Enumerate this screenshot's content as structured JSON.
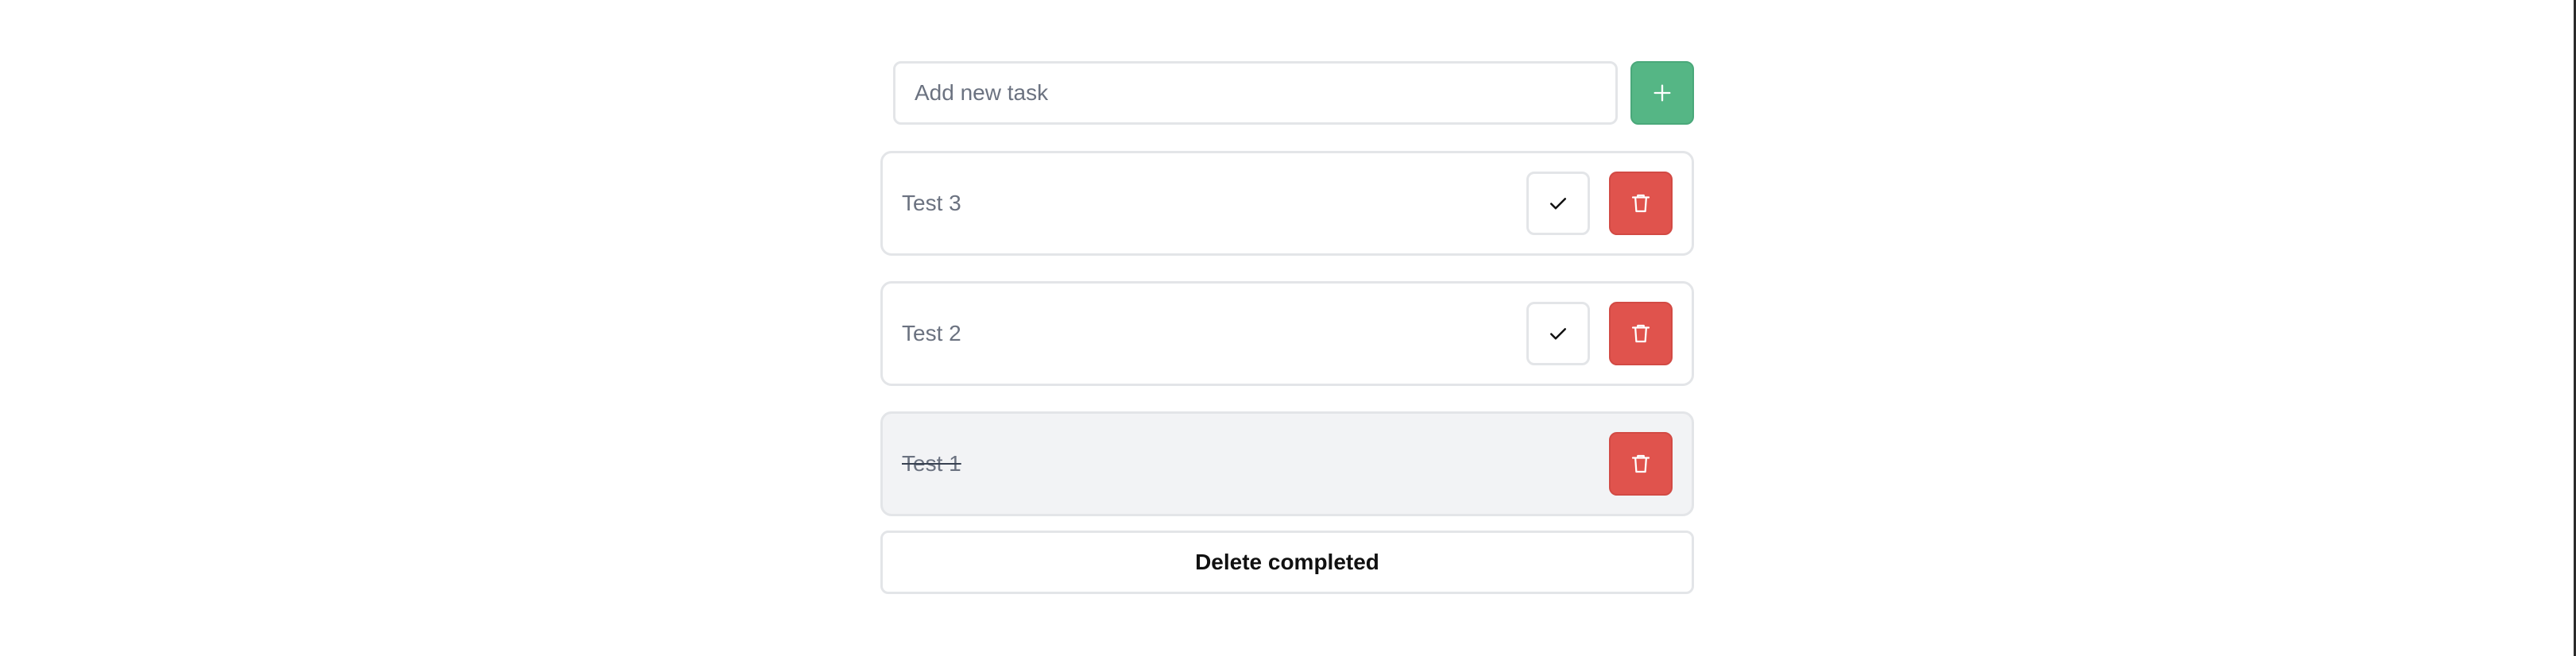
{
  "add_task": {
    "placeholder": "Add new task",
    "value": "",
    "add_icon": "plus-icon"
  },
  "tasks": [
    {
      "label": "Test 3",
      "completed": false
    },
    {
      "label": "Test 2",
      "completed": false
    },
    {
      "label": "Test 1",
      "completed": true
    }
  ],
  "delete_completed_label": "Delete completed",
  "icons": {
    "complete": "check-icon",
    "delete": "trash-icon"
  },
  "colors": {
    "add_green": "#55b685",
    "delete_red": "#e0534d",
    "border": "#e3e5e8",
    "completed_bg": "#f2f3f5"
  }
}
